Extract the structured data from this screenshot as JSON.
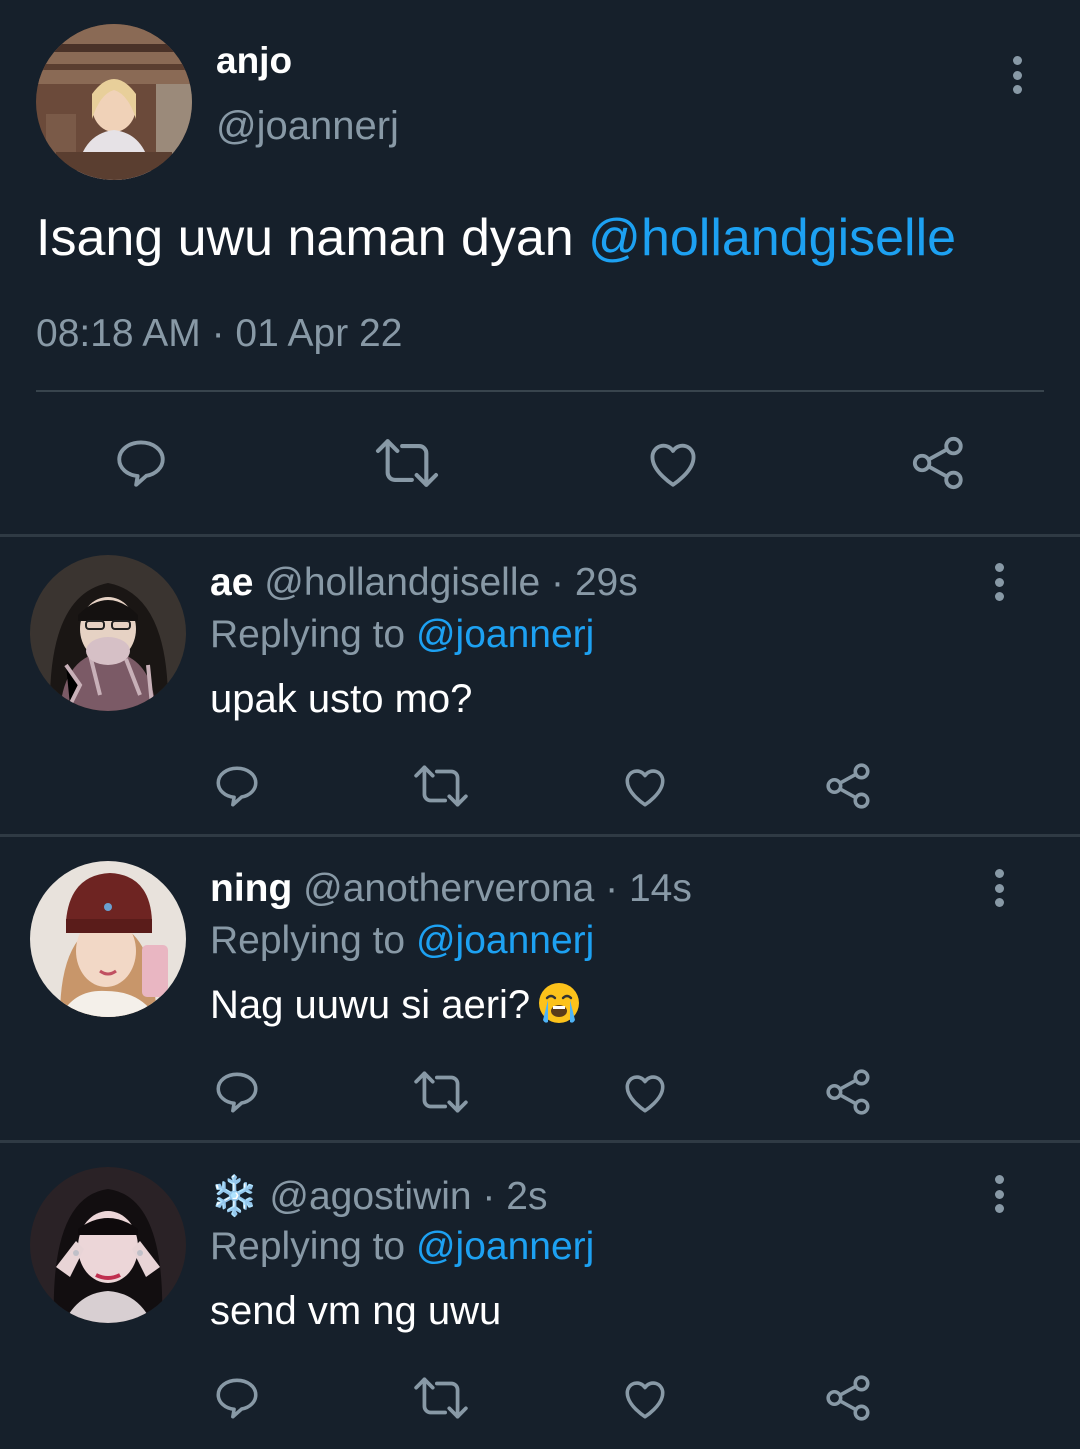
{
  "main_tweet": {
    "name": "anjo",
    "handle": "@joannerj",
    "text": "Isang uwu naman dyan ",
    "mention": "@hollandgiselle",
    "timestamp": "08:18 AM · 01 Apr 22",
    "actions": [
      "reply-icon",
      "retweet-icon",
      "like-icon",
      "share-icon"
    ]
  },
  "replies": [
    {
      "name": "ae",
      "handle": "@hollandgiselle",
      "time": "29s",
      "replying_label": "Replying to ",
      "replying_to": "@joannerj",
      "text": "upak usto mo?"
    },
    {
      "name": "ning",
      "handle": "@anotherverona",
      "time": "14s",
      "replying_label": "Replying to ",
      "replying_to": "@joannerj",
      "text": "Nag uuwu si aeri?",
      "emoji": "loudly-crying-face"
    },
    {
      "name": "❄️",
      "handle": "@agostiwin",
      "time": "2s",
      "replying_label": "Replying to ",
      "replying_to": "@joannerj",
      "text": "send vm ng uwu"
    }
  ],
  "colors": {
    "background": "#16202b",
    "accent": "#1da1f2",
    "secondary_text": "#8899a6",
    "divider": "#38444d"
  }
}
